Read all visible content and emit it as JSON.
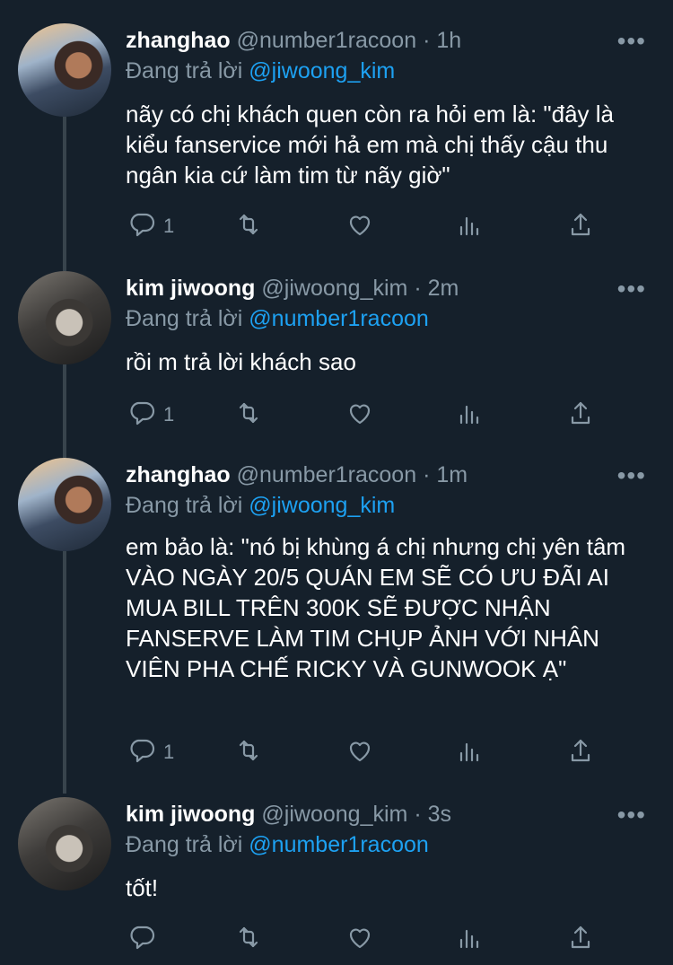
{
  "reply_prefix": "Đang trả lời",
  "tweets": [
    {
      "name": "zhanghao",
      "handle": "@number1racoon",
      "time": "1h",
      "reply_to": "@jiwoong_kim",
      "text": "nãy có chị khách quen còn ra hỏi em là: \"đây là kiểu fanservice mới hả em mà chị thấy cậu thu ngân kia cứ làm tim từ nãy giờ\"",
      "reply_count": "1"
    },
    {
      "name": "kim jiwoong",
      "handle": "@jiwoong_kim",
      "time": "2m",
      "reply_to": "@number1racoon",
      "text": "rồi m trả lời khách sao",
      "reply_count": "1"
    },
    {
      "name": "zhanghao",
      "handle": "@number1racoon",
      "time": "1m",
      "reply_to": "@jiwoong_kim",
      "text": "em bảo là: \"nó bị khùng á chị nhưng chị yên tâm VÀO NGÀY 20/5 QUÁN EM SẼ CÓ ƯU ĐÃI AI MUA BILL TRÊN 300K SẼ ĐƯỢC NHẬN FANSERVE LÀM TIM CHỤP ẢNH VỚI NHÂN VIÊN PHA CHẾ RICKY VÀ GUNWOOK Ạ\"",
      "reply_count": "1"
    },
    {
      "name": "kim jiwoong",
      "handle": "@jiwoong_kim",
      "time": "3s",
      "reply_to": "@number1racoon",
      "text": "tốt!",
      "reply_count": ""
    }
  ],
  "separator": "·",
  "more_icon": "more-icon",
  "colors": {
    "background": "#15202b",
    "secondary": "#8899a6",
    "link": "#1da1f2",
    "thread_line": "#38444d"
  }
}
